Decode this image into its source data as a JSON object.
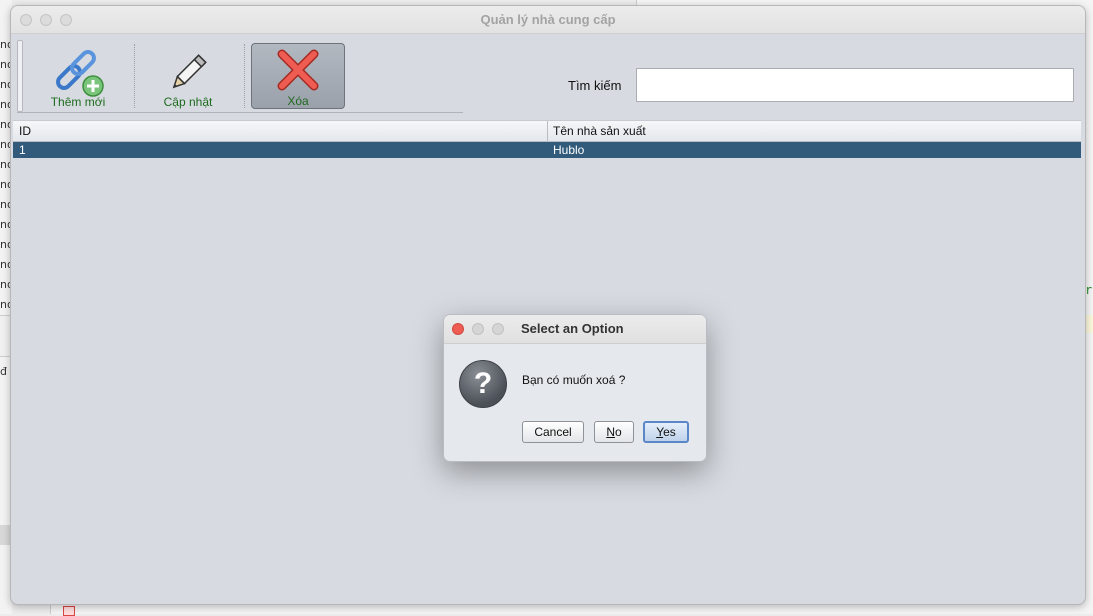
{
  "background": {
    "left_fragments": [
      "no",
      "no",
      "no",
      "no",
      "no",
      "no",
      "no",
      "no",
      "no",
      "no",
      "no",
      "no",
      "no",
      "no",
      "no",
      "đ"
    ],
    "right_fragment": "r"
  },
  "window": {
    "title": "Quản lý nhà cung cấp",
    "toolbar": {
      "add_label": "Thêm mới",
      "update_label": "Cập nhật",
      "delete_label": "Xóa"
    },
    "search": {
      "label": "Tìm kiếm",
      "value": ""
    },
    "table": {
      "columns": [
        "ID",
        "Tên nhà sản xuất"
      ],
      "rows": [
        {
          "id": "1",
          "name": "Hublo",
          "selected": true
        }
      ]
    }
  },
  "dialog": {
    "title": "Select an Option",
    "message": "Bạn có muốn xoá ?",
    "buttons": {
      "cancel": "Cancel",
      "no_mnemonic": "N",
      "no_rest": "o",
      "yes_mnemonic": "Y",
      "yes_rest": "es"
    }
  },
  "colors": {
    "selection": "#315a7b",
    "toolbar_label": "#1e6b1e",
    "default_button_border": "#5b87c9",
    "close_red": "#ee5c52"
  }
}
